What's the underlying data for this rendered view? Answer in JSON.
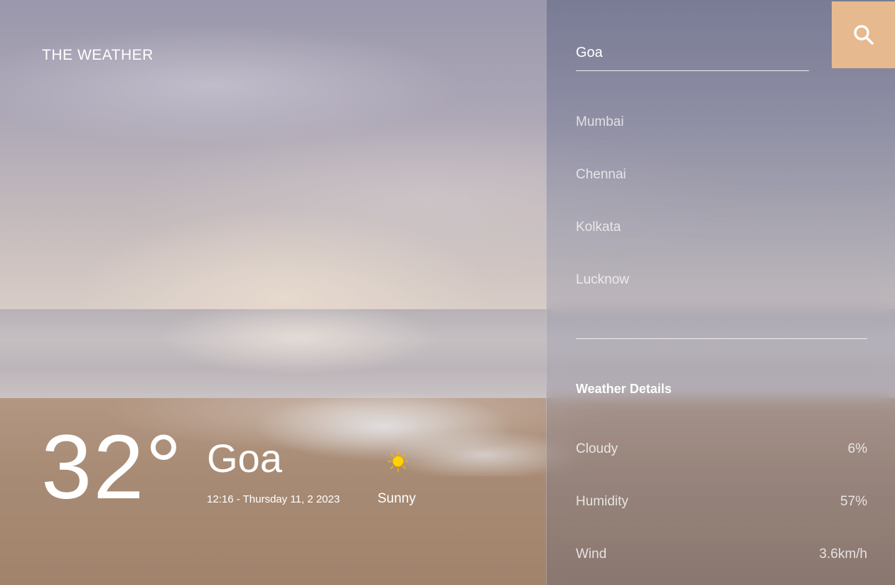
{
  "brand": {
    "title": "THE WEATHER"
  },
  "current": {
    "temperature": "32°",
    "city": "Goa",
    "datetime": "12:16 - Thursday 11, 2 2023",
    "condition": "Sunny",
    "condition_icon": "sun-icon"
  },
  "search": {
    "value": "Goa",
    "button_icon": "search-icon",
    "button_color": "#e6b98e"
  },
  "cities": [
    "Mumbai",
    "Chennai",
    "Kolkata",
    "Lucknow"
  ],
  "details": {
    "heading": "Weather Details",
    "rows": [
      {
        "label": "Cloudy",
        "value": "6%"
      },
      {
        "label": "Humidity",
        "value": "57%"
      },
      {
        "label": "Wind",
        "value": "3.6km/h"
      }
    ]
  }
}
